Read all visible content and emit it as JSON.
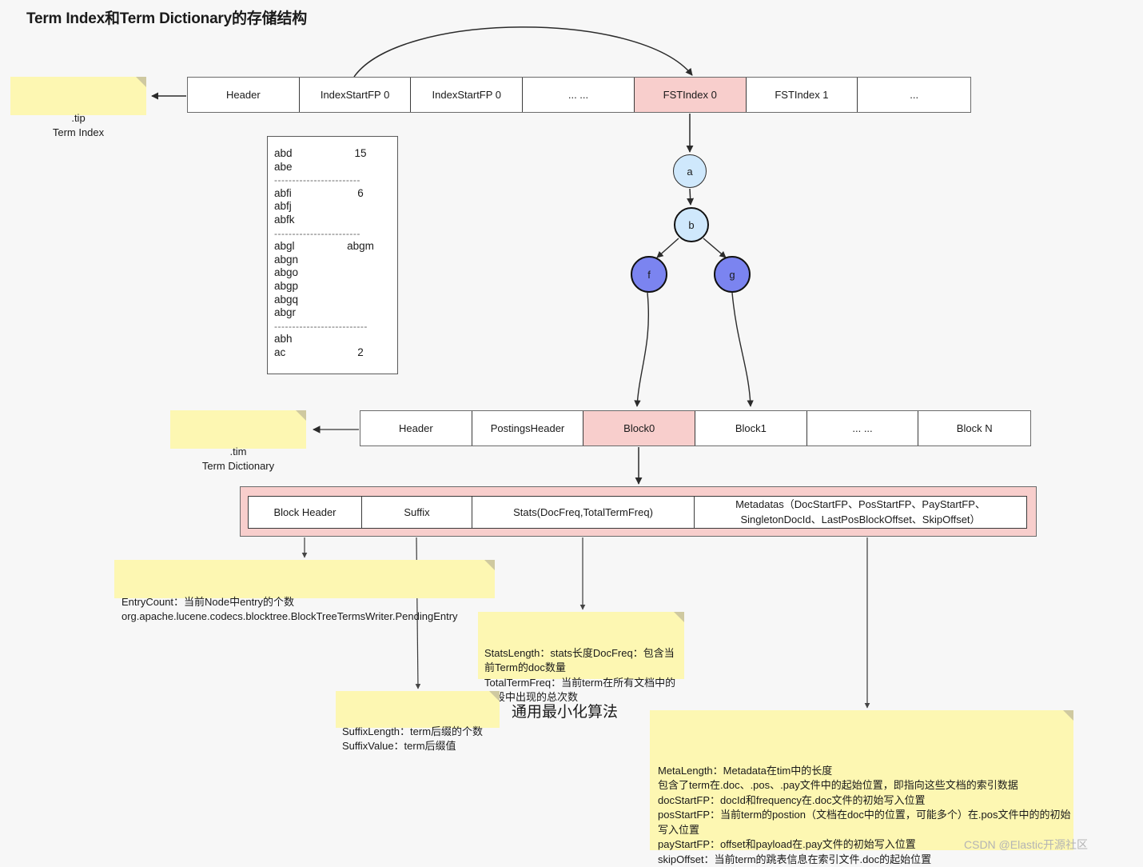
{
  "title": "Term Index和Term Dictionary的存储结构",
  "tip_table": {
    "cells": [
      {
        "label": "Header",
        "highlight": false
      },
      {
        "label": "IndexStartFP 0",
        "highlight": false
      },
      {
        "label": "IndexStartFP 0",
        "highlight": false
      },
      {
        "label": "... ...",
        "highlight": false
      },
      {
        "label": "FSTIndex 0",
        "highlight": true
      },
      {
        "label": "FSTIndex 1",
        "highlight": false
      },
      {
        "label": "...",
        "highlight": false
      }
    ]
  },
  "tim_table": {
    "cells": [
      {
        "label": "Header",
        "highlight": false
      },
      {
        "label": "PostingsHeader",
        "highlight": false
      },
      {
        "label": "Block0",
        "highlight": true
      },
      {
        "label": "Block1",
        "highlight": false
      },
      {
        "label": "... ...",
        "highlight": false
      },
      {
        "label": "Block N",
        "highlight": false
      }
    ]
  },
  "block_detail": {
    "cells": [
      {
        "label": "Block Header"
      },
      {
        "label": "Suffix"
      },
      {
        "label": "Stats(DocFreq,TotalTermFreq)"
      },
      {
        "label": "Metadatas（DocStartFP、PosStartFP、PayStartFP、SingletonDocId、LastPosBlockOffset、SkipOffset）"
      }
    ]
  },
  "term_list": [
    {
      "type": "row",
      "term": "abd",
      "value": "15"
    },
    {
      "type": "row",
      "term": "abe",
      "value": ""
    },
    {
      "type": "sep"
    },
    {
      "type": "row",
      "term": "abfi",
      "value": "6"
    },
    {
      "type": "row",
      "term": "abfj",
      "value": ""
    },
    {
      "type": "row",
      "term": "abfk",
      "value": ""
    },
    {
      "type": "sep"
    },
    {
      "type": "row",
      "term": "abgl",
      "value": "abgm"
    },
    {
      "type": "row",
      "term": "abgn",
      "value": ""
    },
    {
      "type": "row",
      "term": "abgo",
      "value": ""
    },
    {
      "type": "row",
      "term": "abgp",
      "value": ""
    },
    {
      "type": "row",
      "term": "abgq",
      "value": ""
    },
    {
      "type": "row",
      "term": "abgr",
      "value": ""
    },
    {
      "type": "sep"
    },
    {
      "type": "row",
      "term": "abh",
      "value": ""
    },
    {
      "type": "row",
      "term": "ac",
      "value": "2"
    }
  ],
  "fst_nodes": {
    "a": "a",
    "b": "b",
    "f": "f",
    "g": "g"
  },
  "notes": {
    "tip": ".tip\nTerm Index",
    "tim": ".tim\nTerm Dictionary",
    "entry_count": "EntryCount：当前Node中entry的个数\norg.apache.lucene.codecs.blocktree.BlockTreeTermsWriter.PendingEntry",
    "stats": "StatsLength：stats长度DocFreq：包含当前Term的doc数量\nTotalTermFreq：当前term在所有文档中的字段中出现的总次数",
    "suffix": "SuffixLength：term后缀的个数\nSuffixValue：term后缀值",
    "metadata": "MetaLength：Metadata在tim中的长度\n包含了term在.doc、.pos、.pay文件中的起始位置，即指向这些文档的索引数据\ndocStartFP：docId和frequency在.doc文件的初始写入位置\nposStartFP：当前term的postion（文档在doc中的位置，可能多个）在.pos文件中的的初始写入位置\npayStartFP：offset和payload在.pay文件的初始写入位置\nskipOffset：当前term的跳表信息在索引文件.doc的起始位置"
  },
  "labels": {
    "algorithm": "通用最小化算法"
  },
  "watermark": "CSDN @Elastic开源社区",
  "colors": {
    "highlight_fill": "#f8cecc",
    "note_fill": "#fdf7b2",
    "node_level1": "#cfe8fc",
    "node_level3": "#7b84f0",
    "stroke": "#3a3a3a"
  }
}
